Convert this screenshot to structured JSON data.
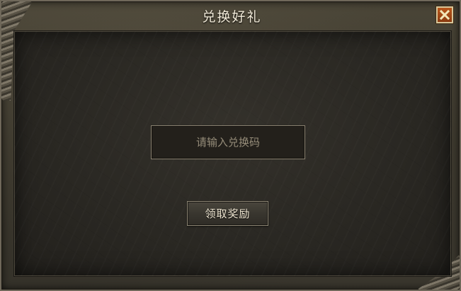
{
  "dialog": {
    "title": "兑换好礼",
    "close_icon": "close-x-icon"
  },
  "redeem": {
    "placeholder": "请输入兑换码",
    "value": "",
    "claim_label": "领取奖励"
  },
  "colors": {
    "close_button": "#b8561a",
    "title_text": "#f1ead8",
    "panel_bg": "#2a2823"
  }
}
